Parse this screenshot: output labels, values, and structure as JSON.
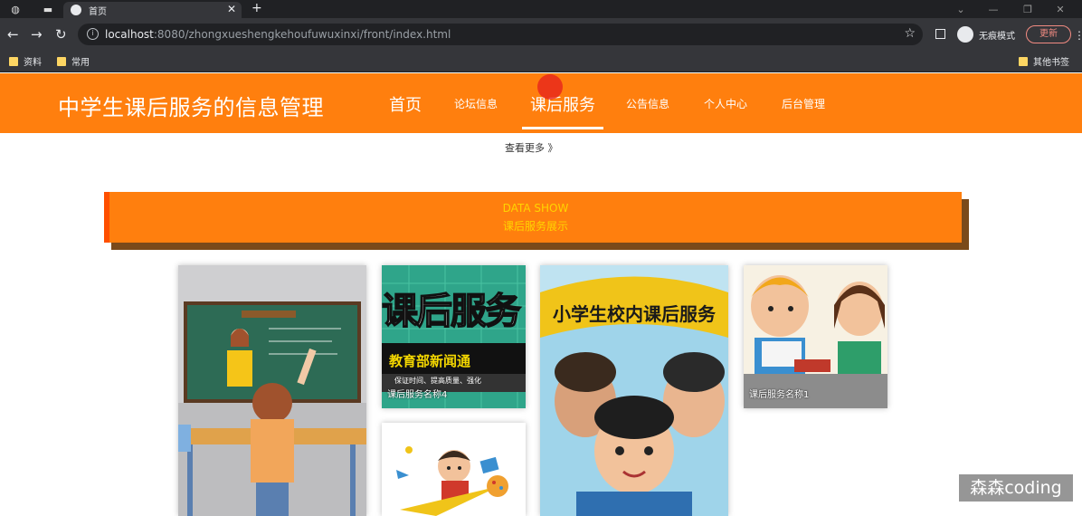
{
  "browser": {
    "tab_title": "首页",
    "url_host": "localhost",
    "url_rest": ":8080/zhongxueshengkehoufuwuxinxi/front/index.html",
    "incognito_label": "无痕模式",
    "update_label": "更新",
    "bookmarks": [
      "资料",
      "常用"
    ],
    "other_bookmarks": "其他书签"
  },
  "site": {
    "title": "中学生课后服务的信息管理",
    "nav": {
      "home": "首页",
      "forum": "论坛信息",
      "service": "课后服务",
      "notice": "公告信息",
      "personal": "个人中心",
      "admin": "后台管理"
    },
    "more_link": "查看更多 》",
    "banner": {
      "en": "DATA SHOW",
      "cn": "课后服务展示"
    },
    "cards": {
      "card2_title": "课后服务",
      "card2_sub": "教育部新闻通",
      "card2_caption": "保证时间、提高质量、强化",
      "card2_label": "课后服务名称4",
      "card3_title": "小学生校内课后服务",
      "card4_label": "课后服务名称1"
    }
  },
  "watermark": "森森coding",
  "colors": {
    "brand_orange": "#ff7f0e",
    "banner_text": "#ffd400",
    "banner_shadow": "#7a4a1a"
  }
}
